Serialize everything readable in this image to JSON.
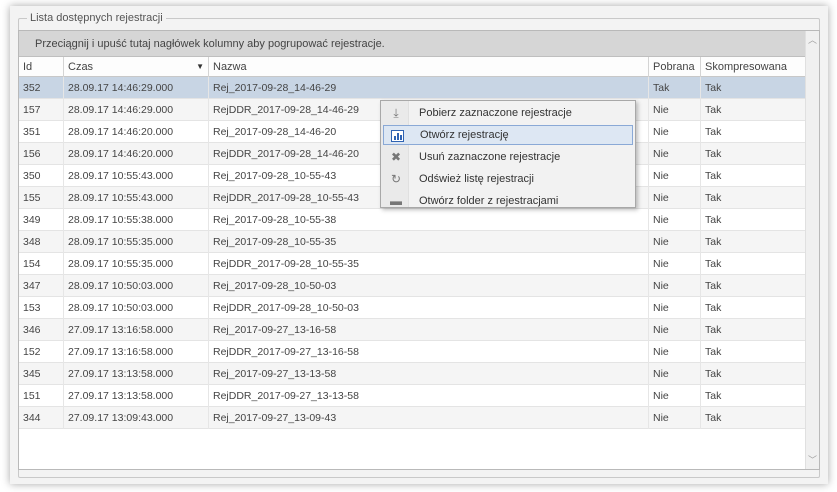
{
  "groupbox_title": "Lista dostępnych rejestracji",
  "group_panel_hint": "Przeciągnij i upuść tutaj nagłówek kolumny aby pogrupować rejestracje.",
  "columns": {
    "id": "Id",
    "czas": "Czas",
    "nazwa": "Nazwa",
    "pobrana": "Pobrana",
    "skompresowana": "Skompresowana"
  },
  "sort_indicator": "▼",
  "rows": [
    {
      "id": "352",
      "czas": "28.09.17 14:46:29.000",
      "nazwa": "Rej_2017-09-28_14-46-29",
      "pobrana": "Tak",
      "skompresowana": "Tak"
    },
    {
      "id": "157",
      "czas": "28.09.17 14:46:29.000",
      "nazwa": "RejDDR_2017-09-28_14-46-29",
      "pobrana": "Nie",
      "skompresowana": "Tak"
    },
    {
      "id": "351",
      "czas": "28.09.17 14:46:20.000",
      "nazwa": "Rej_2017-09-28_14-46-20",
      "pobrana": "Nie",
      "skompresowana": "Tak"
    },
    {
      "id": "156",
      "czas": "28.09.17 14:46:20.000",
      "nazwa": "RejDDR_2017-09-28_14-46-20",
      "pobrana": "Nie",
      "skompresowana": "Tak"
    },
    {
      "id": "350",
      "czas": "28.09.17 10:55:43.000",
      "nazwa": "Rej_2017-09-28_10-55-43",
      "pobrana": "Nie",
      "skompresowana": "Tak"
    },
    {
      "id": "155",
      "czas": "28.09.17 10:55:43.000",
      "nazwa": "RejDDR_2017-09-28_10-55-43",
      "pobrana": "Nie",
      "skompresowana": "Tak"
    },
    {
      "id": "349",
      "czas": "28.09.17 10:55:38.000",
      "nazwa": "Rej_2017-09-28_10-55-38",
      "pobrana": "Nie",
      "skompresowana": "Tak"
    },
    {
      "id": "348",
      "czas": "28.09.17 10:55:35.000",
      "nazwa": "Rej_2017-09-28_10-55-35",
      "pobrana": "Nie",
      "skompresowana": "Tak"
    },
    {
      "id": "154",
      "czas": "28.09.17 10:55:35.000",
      "nazwa": "RejDDR_2017-09-28_10-55-35",
      "pobrana": "Nie",
      "skompresowana": "Tak"
    },
    {
      "id": "347",
      "czas": "28.09.17 10:50:03.000",
      "nazwa": "Rej_2017-09-28_10-50-03",
      "pobrana": "Nie",
      "skompresowana": "Tak"
    },
    {
      "id": "153",
      "czas": "28.09.17 10:50:03.000",
      "nazwa": "RejDDR_2017-09-28_10-50-03",
      "pobrana": "Nie",
      "skompresowana": "Tak"
    },
    {
      "id": "346",
      "czas": "27.09.17 13:16:58.000",
      "nazwa": "Rej_2017-09-27_13-16-58",
      "pobrana": "Nie",
      "skompresowana": "Tak"
    },
    {
      "id": "152",
      "czas": "27.09.17 13:16:58.000",
      "nazwa": "RejDDR_2017-09-27_13-16-58",
      "pobrana": "Nie",
      "skompresowana": "Tak"
    },
    {
      "id": "345",
      "czas": "27.09.17 13:13:58.000",
      "nazwa": "Rej_2017-09-27_13-13-58",
      "pobrana": "Nie",
      "skompresowana": "Tak"
    },
    {
      "id": "151",
      "czas": "27.09.17 13:13:58.000",
      "nazwa": "RejDDR_2017-09-27_13-13-58",
      "pobrana": "Nie",
      "skompresowana": "Tak"
    },
    {
      "id": "344",
      "czas": "27.09.17 13:09:43.000",
      "nazwa": "Rej_2017-09-27_13-09-43",
      "pobrana": "Nie",
      "skompresowana": "Tak"
    }
  ],
  "context_menu": {
    "items": [
      {
        "label": "Pobierz zaznaczone rejestracje",
        "icon": "download-icon"
      },
      {
        "label": "Otwórz rejestrację",
        "icon": "chart-icon"
      },
      {
        "label": "Usuń zaznaczone rejestracje",
        "icon": "delete-icon"
      },
      {
        "label": "Odśwież listę rejestracji",
        "icon": "refresh-icon"
      },
      {
        "label": "Otwórz folder z rejestracjami",
        "icon": "folder-icon"
      }
    ],
    "highlighted_index": 1
  },
  "colors": {
    "selected_row": "#c8d5e4",
    "menu_highlight": "#dde7f3",
    "menu_highlight_border": "#8aa9d6",
    "group_panel": "#d6d6d6"
  }
}
